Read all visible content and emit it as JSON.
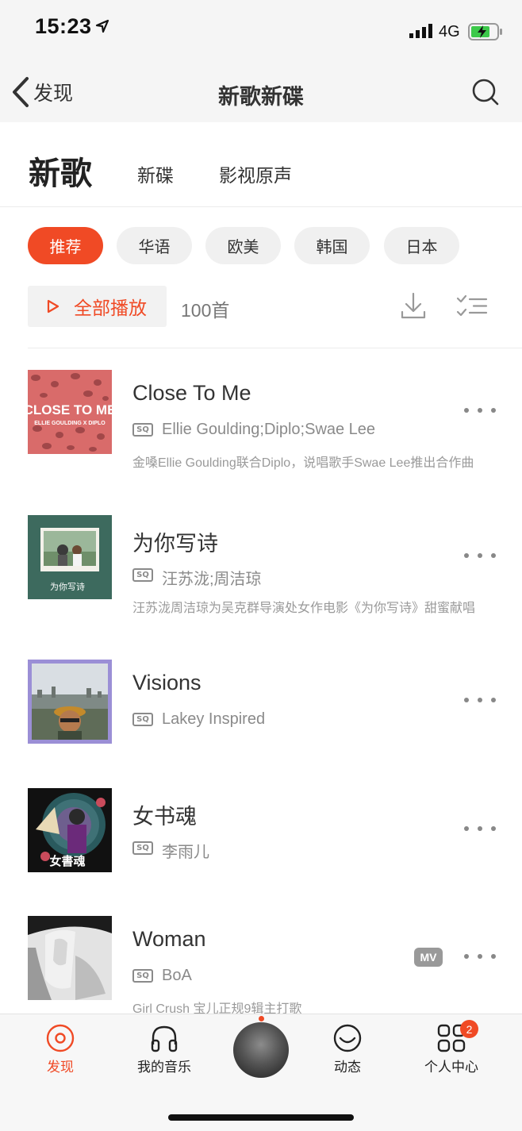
{
  "status_bar": {
    "time": "15:23",
    "network": "4G"
  },
  "nav": {
    "back_label": "发现",
    "title": "新歌新碟"
  },
  "tabs": [
    {
      "label": "新歌"
    },
    {
      "label": "新碟"
    },
    {
      "label": "影视原声"
    }
  ],
  "filters": [
    {
      "label": "推荐"
    },
    {
      "label": "华语"
    },
    {
      "label": "欧美"
    },
    {
      "label": "韩国"
    },
    {
      "label": "日本"
    }
  ],
  "toolbar": {
    "play_all_label": "全部播放",
    "count_label": "100首"
  },
  "songs": [
    {
      "title": "Close To Me",
      "quality": "SQ",
      "artist": "Ellie Goulding;Diplo;Swae Lee",
      "description": "金嗓Ellie Goulding联合Diplo，说唱歌手Swae Lee推出合作曲",
      "cover_text": "CLOSE TO ME",
      "cover_sub": "ELLIE GOULDING X DIPLO"
    },
    {
      "title": "为你写诗",
      "quality": "SQ",
      "artist": "汪苏泷;周洁琼",
      "description": "汪苏泷周洁琼为吴克群导演处女作电影《为你写诗》甜蜜献唱",
      "cover_text": "为你写诗"
    },
    {
      "title": "Visions",
      "quality": "SQ",
      "artist": "Lakey Inspired"
    },
    {
      "title": "女书魂",
      "quality": "SQ",
      "artist": "李雨儿",
      "cover_text": "女書魂"
    },
    {
      "title": "Woman",
      "quality": "SQ",
      "artist": "BoA",
      "mv_label": "MV",
      "description": "Girl Crush 宝儿正规9辑主打歌"
    }
  ],
  "bottom_tabs": [
    {
      "label": "发现"
    },
    {
      "label": "我的音乐"
    },
    {
      "label": "动态"
    },
    {
      "label": "个人中心",
      "badge": "2"
    }
  ],
  "colors": {
    "accent": "#f04a25",
    "chip_bg": "#f0f0f0",
    "text_primary": "#333333",
    "text_secondary": "#8a8a8a"
  },
  "icons": {
    "back": "chevron-left-icon",
    "search": "search-icon",
    "play": "play-icon",
    "download": "download-icon",
    "multi_select": "checklist-icon",
    "more": "more-dots-icon"
  }
}
